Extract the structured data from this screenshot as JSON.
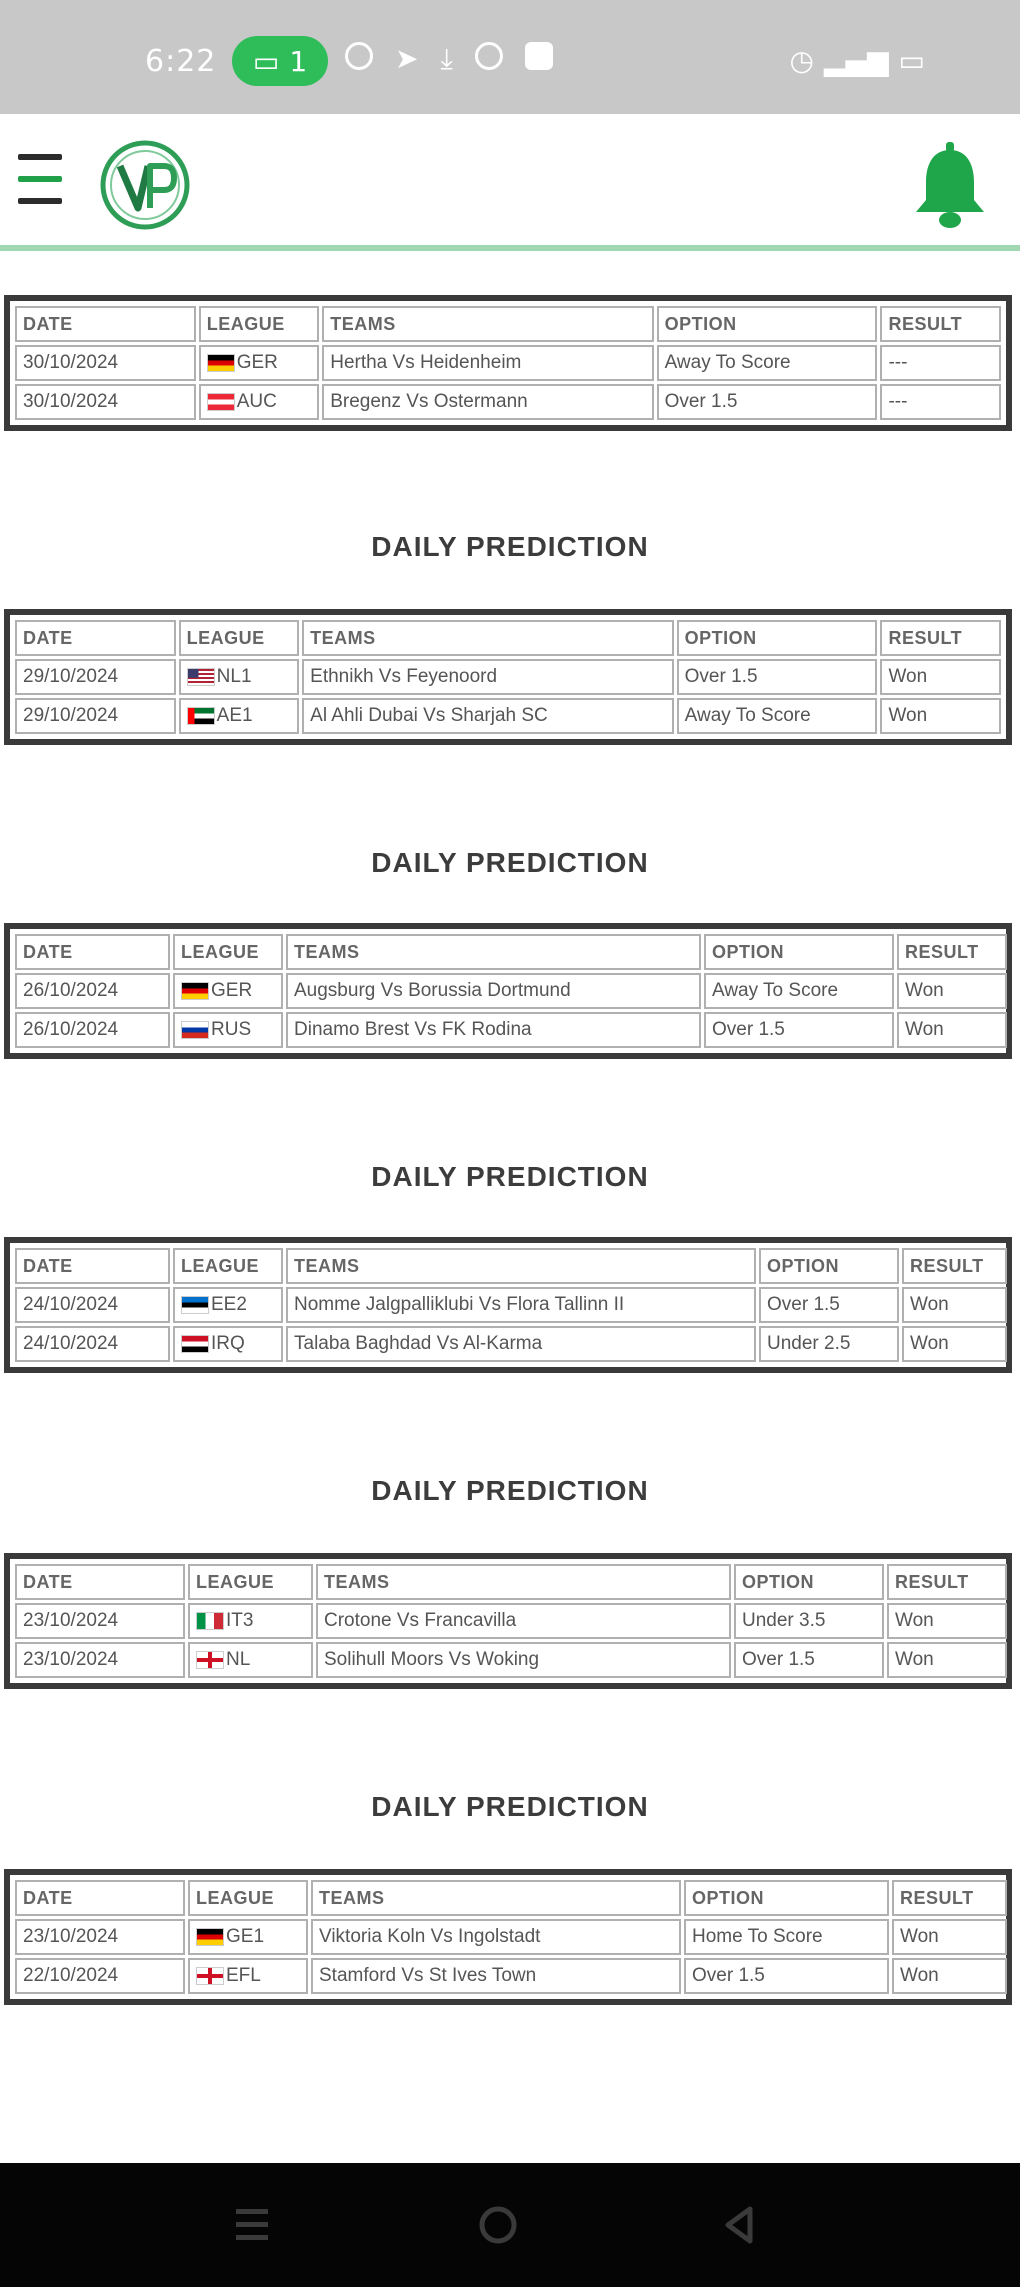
{
  "status_bar": {
    "time": "6:22",
    "badge_count": "1"
  },
  "colors": {
    "accent_green": "#21a04a",
    "status_pill": "#2fbd5a",
    "header_divider": "#9fd8b3",
    "table_border": "#3a3a3a"
  },
  "header": {
    "menu_icon": "menu-icon",
    "logo_text": "VP",
    "bell_icon": "bell-icon"
  },
  "columns": [
    "DATE",
    "LEAGUE",
    "TEAMS",
    "OPTION",
    "RESULT"
  ],
  "sections": [
    {
      "heading": "",
      "rows": [
        {
          "date": "30/10/2024",
          "flag": "de",
          "league": "GER",
          "teams": "Hertha Vs Heidenheim",
          "option": "Away To Score",
          "result": "---"
        },
        {
          "date": "30/10/2024",
          "flag": "at",
          "league": "AUC",
          "teams": "Bregenz Vs Ostermann",
          "option": "Over 1.5",
          "result": "---"
        }
      ]
    },
    {
      "heading": "DAILY PREDICTION",
      "rows": [
        {
          "date": "29/10/2024",
          "flag": "us",
          "league": "NL1",
          "teams": "Ethnikh Vs Feyenoord",
          "option": "Over 1.5",
          "result": "Won"
        },
        {
          "date": "29/10/2024",
          "flag": "ae",
          "league": "AE1",
          "teams": "Al Ahli Dubai Vs Sharjah SC",
          "option": "Away To Score",
          "result": "Won"
        }
      ]
    },
    {
      "heading": "DAILY PREDICTION",
      "rows": [
        {
          "date": "26/10/2024",
          "flag": "de",
          "league": "GER",
          "teams": "Augsburg Vs Borussia Dortmund",
          "option": "Away To Score",
          "result": "Won"
        },
        {
          "date": "26/10/2024",
          "flag": "ru",
          "league": "RUS",
          "teams": "Dinamo Brest Vs FK Rodina",
          "option": "Over 1.5",
          "result": "Won"
        }
      ]
    },
    {
      "heading": "DAILY PREDICTION",
      "rows": [
        {
          "date": "24/10/2024",
          "flag": "ee",
          "league": "EE2",
          "teams": "Nomme Jalgpalliklubi Vs Flora Tallinn II",
          "option": "Over 1.5",
          "result": "Won"
        },
        {
          "date": "24/10/2024",
          "flag": "iq",
          "league": "IRQ",
          "teams": "Talaba Baghdad Vs Al-Karma",
          "option": "Under 2.5",
          "result": "Won"
        }
      ]
    },
    {
      "heading": "DAILY PREDICTION",
      "rows": [
        {
          "date": "23/10/2024",
          "flag": "it",
          "league": "IT3",
          "teams": "Crotone Vs Francavilla",
          "option": "Under 3.5",
          "result": "Won"
        },
        {
          "date": "23/10/2024",
          "flag": "en",
          "league": "NL",
          "teams": "Solihull Moors Vs Woking",
          "option": "Over 1.5",
          "result": "Won"
        }
      ]
    },
    {
      "heading": "DAILY PREDICTION",
      "rows": [
        {
          "date": "23/10/2024",
          "flag": "de",
          "league": "GE1",
          "teams": "Viktoria Koln Vs Ingolstadt",
          "option": "Home To Score",
          "result": "Won"
        },
        {
          "date": "22/10/2024",
          "flag": "en",
          "league": "EFL",
          "teams": "Stamford Vs St Ives Town",
          "option": "Over 1.5",
          "result": "Won"
        }
      ]
    }
  ]
}
